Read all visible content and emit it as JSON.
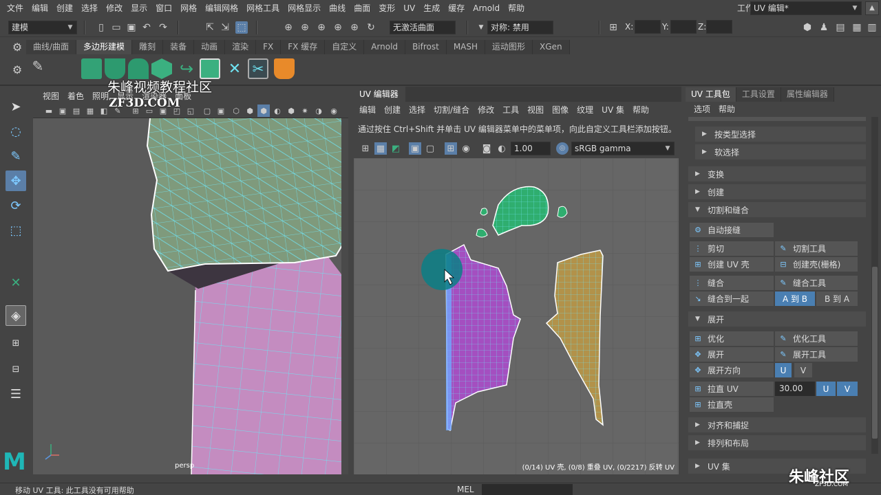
{
  "menubar": {
    "items": [
      "文件",
      "编辑",
      "创建",
      "选择",
      "修改",
      "显示",
      "窗口",
      "网格",
      "编辑网格",
      "网格工具",
      "网格显示",
      "曲线",
      "曲面",
      "变形",
      "UV",
      "生成",
      "缓存",
      "Arnold",
      "帮助"
    ],
    "workspace_label": "工作区:",
    "workspace_value": "UV 编辑*"
  },
  "statusline": {
    "mode": "建模",
    "surface": "无激活曲面",
    "symmetry": "对称: 禁用",
    "x_label": "X:",
    "y_label": "Y:",
    "z_label": "Z:"
  },
  "shelf": {
    "tabs": [
      "曲线/曲面",
      "多边形建模",
      "雕刻",
      "装备",
      "动画",
      "渲染",
      "FX",
      "FX 缓存",
      "自定义",
      "Arnold",
      "Bifrost",
      "MASH",
      "运动图形",
      "XGen"
    ],
    "active_tab": "多边形建模"
  },
  "viewport": {
    "menu": [
      "视图",
      "着色",
      "照明",
      "显示",
      "渲染器",
      "面板"
    ],
    "camera_label": "persp"
  },
  "watermark": {
    "line1": "朱峰视频教程社区",
    "line2": "ZF3D.COM"
  },
  "uv_editor": {
    "tab": "UV 编辑器",
    "menu": [
      "编辑",
      "创建",
      "选择",
      "切割/缝合",
      "修改",
      "工具",
      "视图",
      "图像",
      "纹理",
      "UV 集",
      "帮助"
    ],
    "hint": "通过按住 Ctrl+Shift 并单击 UV 编辑器菜单中的菜单项，向此自定义工具栏添加按钮。",
    "exposure": "1.00",
    "color_space": "sRGB gamma",
    "status": "(0/14) UV 壳, (0/8) 重叠 UV, (0/2217) 反转 UV"
  },
  "right_panel": {
    "tabs": [
      "UV 工具包",
      "工具设置",
      "属性编辑器"
    ],
    "menu": [
      "选项",
      "帮助"
    ],
    "sections": {
      "by_type": "按类型选择",
      "soft": "软选择",
      "transform": "变换",
      "create": "创建",
      "cut_sew": "切割和缝合",
      "unfold": "展开",
      "align": "对齐和捕捉",
      "arrange": "排列和布局",
      "uvset": "UV 集"
    },
    "buttons": {
      "auto_seams": "自动接缝",
      "cut": "剪切",
      "cut_tool": "切割工具",
      "create_uv_shell": "创建 UV 壳",
      "create_shell_grid": "创建壳(栅格)",
      "sew": "缝合",
      "sew_tool": "缝合工具",
      "sew_together": "缝合到一起",
      "a_to_b": "A 到 B",
      "b_to_a": "B 到 A",
      "optimize": "优化",
      "optimize_tool": "优化工具",
      "unfold": "展开",
      "unfold_tool": "展开工具",
      "unfold_dir": "展开方向",
      "u": "U",
      "v": "V",
      "straighten_uv": "拉直 UV",
      "straighten_value": "30.00",
      "straighten_shell": "拉直壳"
    }
  },
  "helpline": {
    "text": "移动 UV 工具: 此工具没有可用帮助",
    "mel": "MEL"
  },
  "brand": {
    "name": "朱峰社区",
    "url": "ZF3D.COM"
  },
  "colors": {
    "accent_blue": "#4a7fb2",
    "uv_green": "#2fae6f",
    "uv_magenta": "#a44fc0",
    "uv_ochre": "#b2924a",
    "wire_cyan": "#6fe3f2",
    "maya_teal": "#1fb7b7"
  }
}
